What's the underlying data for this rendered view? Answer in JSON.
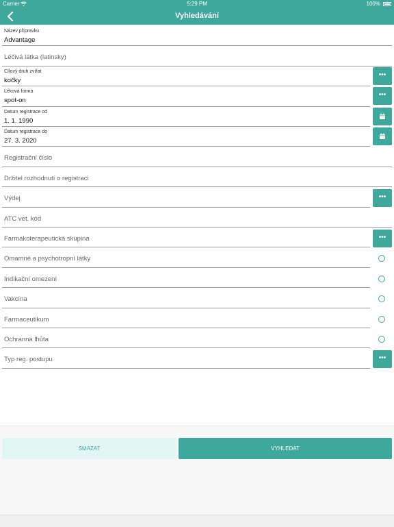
{
  "status_bar": {
    "carrier": "Carrier",
    "time": "5:29 PM",
    "battery": "100%"
  },
  "nav": {
    "title": "Vyhledávání"
  },
  "fields": {
    "nazev": {
      "label": "Název přípravku",
      "value": "Advantage"
    },
    "lecivalatka": {
      "placeholder": "Léčivá látka (latinsky)"
    },
    "cilovy": {
      "label": "Cílový druh zvířat",
      "value": "kočky"
    },
    "forma": {
      "label": "Léková forma",
      "value": "spot-on"
    },
    "datumod": {
      "label": "Datum registrace od",
      "value": "1. 1. 1990"
    },
    "datumdo": {
      "label": "Datum registrace do",
      "value": "27. 3. 2020"
    },
    "regcislo": {
      "placeholder": "Registrační číslo"
    },
    "drzitel": {
      "placeholder": "Držitel rozhodnutí o registraci"
    },
    "vydej": {
      "placeholder": "Výdej"
    },
    "atc": {
      "placeholder": "ATC vet. kód"
    },
    "farmako": {
      "placeholder": "Farmakoterapeutická skupina"
    },
    "omamne": {
      "placeholder": "Omamné a psychotropní látky"
    },
    "indikacni": {
      "placeholder": "Indikační omezení"
    },
    "vakcina": {
      "placeholder": "Vakcína"
    },
    "farmaceutikum": {
      "placeholder": "Farmaceutikum"
    },
    "ochranna": {
      "placeholder": "Ochranná lhůta"
    },
    "typreg": {
      "placeholder": "Typ reg. postupu"
    }
  },
  "picker_glyph": "•••",
  "buttons": {
    "clear": "SMAZAT",
    "search": "VYHLEDAT"
  },
  "colors": {
    "accent": "#3fa89c",
    "accent_light": "#e2f7f3"
  }
}
